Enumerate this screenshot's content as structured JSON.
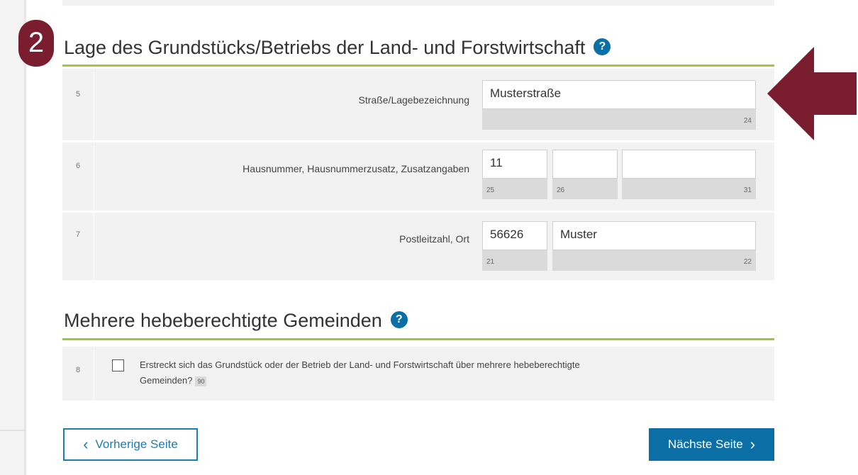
{
  "step": {
    "number": "2"
  },
  "section1": {
    "title": "Lage des Grundstücks/Betriebs der Land- und Forstwirtschaft",
    "help_icon": "?",
    "rows": [
      {
        "number": "5",
        "label": "Straße/Lagebezeichnung",
        "fields": [
          {
            "value": "Musterstraße",
            "code": "24"
          }
        ]
      },
      {
        "number": "6",
        "label": "Hausnummer,  Hausnummerzusatz,  Zusatzangaben",
        "fields": [
          {
            "value": "11",
            "code": "25"
          },
          {
            "value": "",
            "code": "26"
          },
          {
            "value": "",
            "code": "31"
          }
        ]
      },
      {
        "number": "7",
        "label": "Postleitzahl,  Ort",
        "fields": [
          {
            "value": "56626",
            "code": "21"
          },
          {
            "value": "Muster",
            "code": "22"
          }
        ]
      }
    ]
  },
  "section2": {
    "title": "Mehrere hebeberechtigte Gemeinden",
    "help_icon": "?",
    "row": {
      "number": "8",
      "checked": false,
      "line1": "Erstreckt sich das Grundstück oder der Betrieb der Land- und Forstwirtschaft über mehrere hebeberechtigte",
      "line2": "Gemeinden?",
      "code": "90"
    }
  },
  "nav": {
    "prev_label": "Vorherige Seite",
    "next_label": "Nächste Seite",
    "prev_icon": "chevron-left-icon",
    "next_icon": "chevron-right-icon"
  },
  "colors": {
    "badge": "#7a1d2e",
    "accent_green": "#9dc83b",
    "primary_blue": "#0b6fa6",
    "arrow": "#7a1d2e"
  }
}
